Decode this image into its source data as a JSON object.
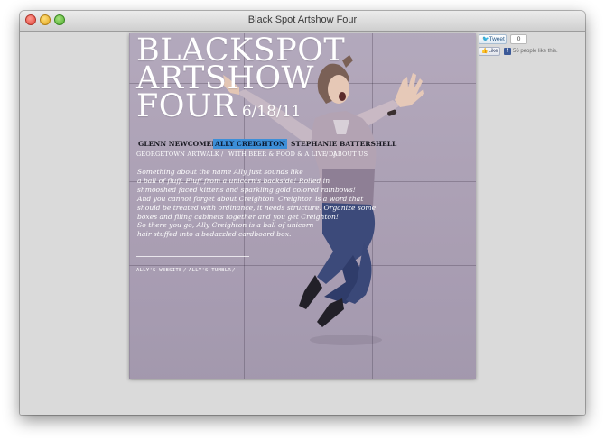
{
  "window": {
    "title": "Black Spot Artshow Four"
  },
  "poster": {
    "headline": {
      "line1": "BLACKSPOT",
      "line2": "ARTSHOW",
      "line3": "FOUR",
      "date": "6/18/11"
    },
    "artists": [
      "GLENN NEWCOMER",
      "ALLY CREIGHTON",
      "STEPHANIE BATTERSHELL"
    ],
    "selected_artist": "ALLY CREIGHTON",
    "subnav": {
      "item1": "GEORGETOWN ARTWALK",
      "sep1": "/",
      "item2": "WITH BEER & FOOD & A LIVE DJ",
      "sep2": "/",
      "item3": "ABOUT US"
    },
    "blurb_lines": [
      "Something about the name Ally just sounds like",
      "a ball of fluff. Fluff from a unicorn's backside! Rolled in",
      "shmooshed faced kittens and sparkling gold colored rainbows!",
      "And you cannot forget about Creighton. Creighton is a word that",
      "should be treated with ordinance, it needs structure. Organize some",
      "boxes and filing cabinets together and you get Creighton!",
      "So there you go, Ally Creighton is a ball of unicorn",
      "hair stuffed into a bedazzled cardboard box."
    ],
    "links": {
      "website": "ALLY'S WEBSITE",
      "sep1": "/",
      "tumblr": "ALLY'S TUMBLR",
      "sep2": "/"
    }
  },
  "social": {
    "tweet_label": "Tweet",
    "tweet_icon": "bird-icon",
    "tweet_count": "0",
    "like_label": "Like",
    "like_icon": "thumbs-up-icon",
    "facebook_icon_letter": "f",
    "like_text": "56 people like this."
  },
  "colors": {
    "highlight": "#3d8fd8",
    "wall": "#b4a8bf",
    "facebook": "#3b5998"
  }
}
